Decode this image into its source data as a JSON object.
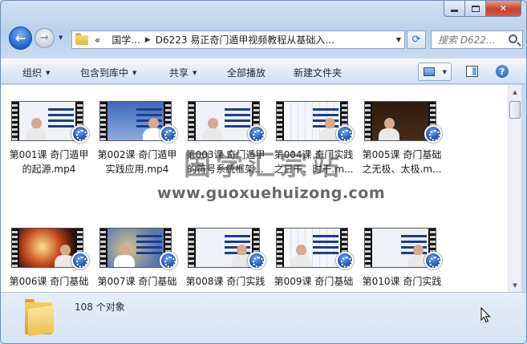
{
  "address": {
    "crumbs": [
      "«",
      "国学...",
      "D6223 易正奇门遁甲视频教程从基础入..."
    ]
  },
  "search": {
    "placeholder": "搜索 D622..."
  },
  "toolbar": {
    "organize": "组织",
    "include_library": "包含到库中",
    "share": "共享",
    "play_all": "全部播放",
    "new_folder": "新建文件夹"
  },
  "files": [
    {
      "line1": "第001课 奇门遁甲",
      "line2": "的起源.mp4"
    },
    {
      "line1": "第002课 奇门遁甲",
      "line2": "实践应用.mp4"
    },
    {
      "line1": "第003课 奇门遁甲",
      "line2": "的符号系统框架..."
    },
    {
      "line1": "第004课 奇门实践",
      "line2": "之日干、时干.m..."
    },
    {
      "line1": "第005课 奇门基础",
      "line2": "之无极、太极.m..."
    },
    {
      "line1": "第006课 奇门基础",
      "line2": ""
    },
    {
      "line1": "第007课 奇门基础",
      "line2": ""
    },
    {
      "line1": "第008课 奇门实践",
      "line2": ""
    },
    {
      "line1": "第009课 奇门基础",
      "line2": ""
    },
    {
      "line1": "第010课 奇门实践",
      "line2": ""
    }
  ],
  "status": {
    "count": "108 个对象"
  },
  "watermark": {
    "cn": "国学汇宗站",
    "url": "www.guoxuehuizong.com"
  },
  "colors": {
    "accent": "#1f5fc8",
    "window_frame": "#b9d0ec",
    "close": "#c8412b"
  }
}
